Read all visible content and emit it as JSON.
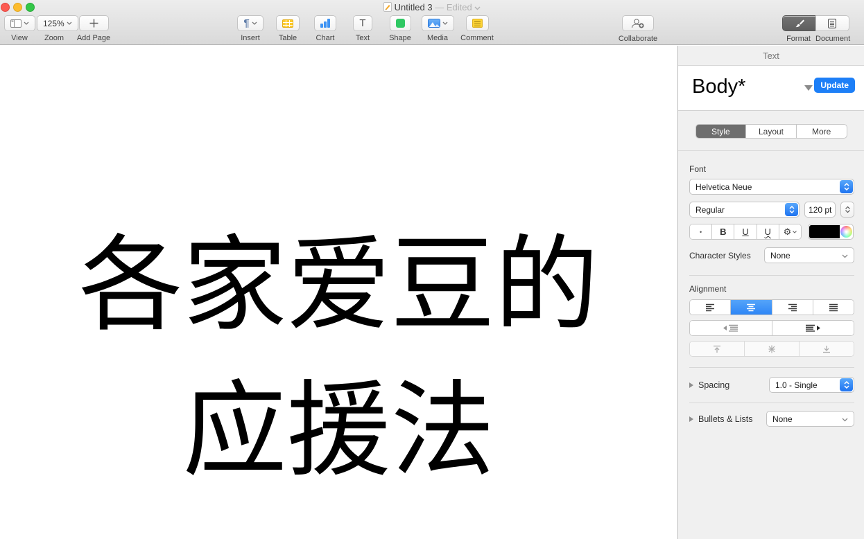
{
  "window": {
    "title": "Untitled 3",
    "edited": "— Edited"
  },
  "toolbar": {
    "view": {
      "label": "View"
    },
    "zoom": {
      "label": "Zoom",
      "value": "125%"
    },
    "add_page": {
      "label": "Add Page"
    },
    "insert": {
      "label": "Insert",
      "glyph": "¶"
    },
    "table": {
      "label": "Table"
    },
    "chart": {
      "label": "Chart"
    },
    "text": {
      "label": "Text",
      "glyph": "T"
    },
    "shape": {
      "label": "Shape"
    },
    "media": {
      "label": "Media"
    },
    "comment": {
      "label": "Comment"
    },
    "collaborate": {
      "label": "Collaborate"
    },
    "format": {
      "label": "Format"
    },
    "document_btn": {
      "label": "Document"
    }
  },
  "document": {
    "lines": [
      "各家爱豆的",
      "应援法"
    ]
  },
  "inspector": {
    "header": "Text",
    "style_name": "Body*",
    "update_label": "Update",
    "tabs": {
      "style": "Style",
      "layout": "Layout",
      "more": "More"
    },
    "font": {
      "section_label": "Font",
      "family": "Helvetica Neue",
      "weight": "Regular",
      "size": "120 pt",
      "bold_glyph": "B",
      "underline_glyph": "U",
      "wavy_underline_glyph": "U",
      "dot_glyph": "•",
      "gear_glyph": "⚙"
    },
    "character_styles": {
      "label": "Character Styles",
      "value": "None"
    },
    "alignment": {
      "section_label": "Alignment"
    },
    "spacing": {
      "label": "Spacing",
      "value": "1.0 - Single"
    },
    "bullets": {
      "label": "Bullets & Lists",
      "value": "None"
    }
  },
  "colors": {
    "accent_blue": "#1d7ff7",
    "alignment_active_blue": "#3e95f7",
    "active_segment_gray": "#6e6e6e",
    "text_color_well": "#000000"
  }
}
